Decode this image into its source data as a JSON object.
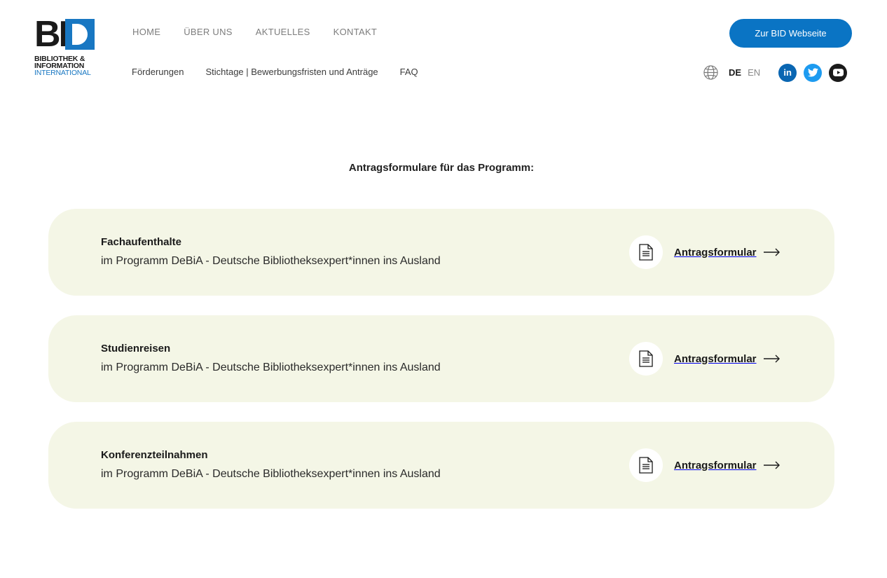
{
  "logo": {
    "mark_b": "BI",
    "line1": "BIBLIOTHEK &",
    "line2": "INFORMATION",
    "line3": "INTERNATIONAL"
  },
  "nav": {
    "primary": [
      "HOME",
      "ÜBER UNS",
      "AKTUELLES",
      "KONTAKT"
    ],
    "secondary": [
      "Förderungen",
      "Stichtage | Bewerbungsfristen und Anträge",
      "FAQ"
    ]
  },
  "header": {
    "cta_label": "Zur BID Webseite",
    "lang_active": "DE",
    "lang_other": "EN",
    "language_icon": "globe-icon",
    "social": [
      {
        "icon": "linkedin-icon",
        "glyph": "in"
      },
      {
        "icon": "twitter-icon",
        "glyph": ""
      },
      {
        "icon": "youtube-icon",
        "glyph": ""
      }
    ]
  },
  "main": {
    "title": "Antragsformulare für das Programm:",
    "cards": [
      {
        "title": "Fachaufenthalte",
        "subtitle": "im Programm DeBiA - Deutsche Bibliotheksexpert*innen ins Ausland",
        "action": "Antragsformular"
      },
      {
        "title": "Studienreisen",
        "subtitle": "im Programm DeBiA - Deutsche Bibliotheksexpert*innen ins Ausland",
        "action": "Antragsformular"
      },
      {
        "title": "Konferenzteilnahmen",
        "subtitle": "im Programm DeBiA - Deutsche Bibliotheksexpert*innen ins Ausland",
        "action": "Antragsformular"
      }
    ]
  },
  "colors": {
    "brand_blue": "#0a74c4",
    "card_bg": "#f4f6e6",
    "linkedin": "#0a66b2",
    "twitter": "#1d9bf0",
    "youtube": "#1a1a1a"
  }
}
